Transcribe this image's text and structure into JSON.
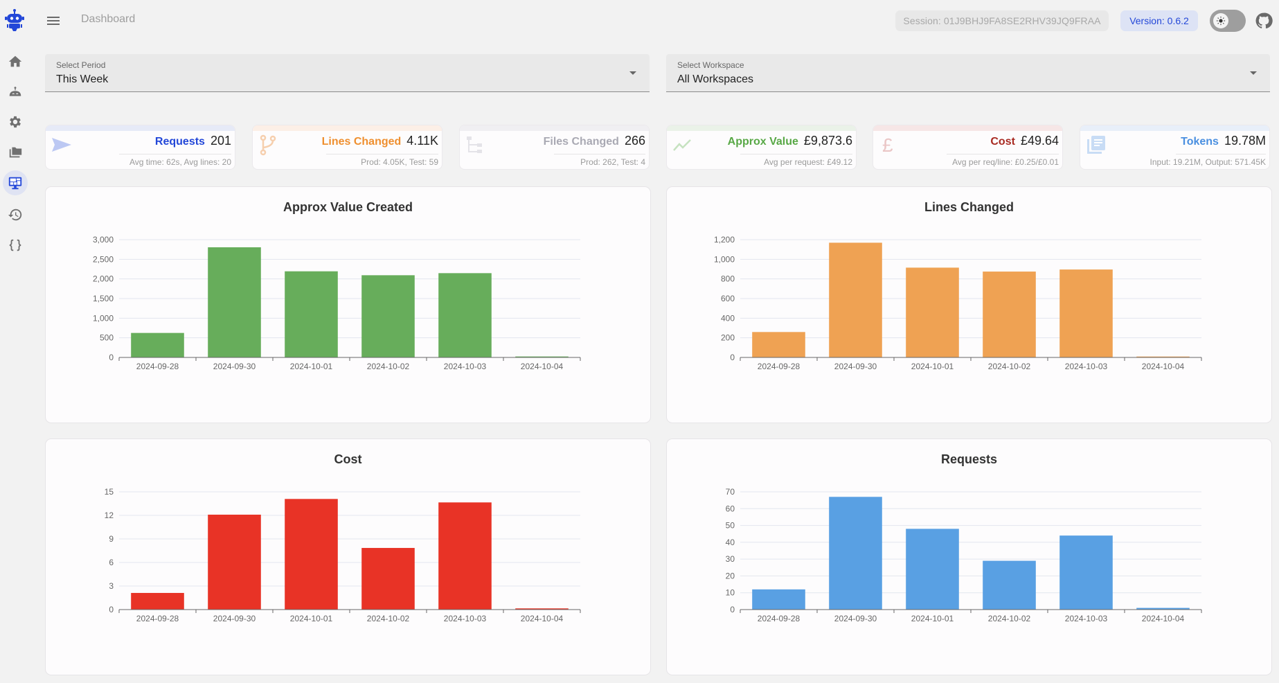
{
  "app": {
    "page_title": "Dashboard",
    "session_label": "Session: 01J9BHJ9FA8SE2RHV39JQ9FRAA",
    "version_label": "Version: 0.6.2",
    "brand_color": "#2347d8"
  },
  "sidebar": {
    "items": [
      {
        "name": "home",
        "icon": "home-icon",
        "active": false
      },
      {
        "name": "agents",
        "icon": "robot-icon",
        "active": false
      },
      {
        "name": "settings",
        "icon": "gear-icon",
        "active": false
      },
      {
        "name": "workspaces",
        "icon": "folders-icon",
        "active": false
      },
      {
        "name": "dashboard",
        "icon": "dashboard-monitor-icon",
        "active": true
      },
      {
        "name": "history",
        "icon": "history-icon",
        "active": false
      },
      {
        "name": "api",
        "icon": "code-braces-icon",
        "active": false
      }
    ]
  },
  "filters": {
    "period": {
      "label": "Select Period",
      "value": "This Week"
    },
    "workspace": {
      "label": "Select Workspace",
      "value": "All Workspaces"
    }
  },
  "stats": [
    {
      "key": "requests",
      "title": "Requests",
      "value": "201",
      "sub": "Avg time: 62s, Avg lines: 20",
      "color": "#2347d8",
      "band": "#e6eaf7",
      "icon": "send-icon"
    },
    {
      "key": "lines",
      "title": "Lines Changed",
      "value": "4.11K",
      "sub": "Prod: 4.05K, Test: 59",
      "color": "#ef8f2f",
      "band": "#fcefe6",
      "icon": "branch-icon"
    },
    {
      "key": "files",
      "title": "Files Changed",
      "value": "266",
      "sub": "Prod: 262, Test: 4",
      "color": "#a9a9b3",
      "band": "#f0eff2",
      "icon": "file-tree-icon"
    },
    {
      "key": "value",
      "title": "Approx Value",
      "value": "£9,873.6",
      "sub": "Avg per request: £49.12",
      "color": "#58a846",
      "band": "#eaf2e8",
      "icon": "trending-up-icon"
    },
    {
      "key": "cost",
      "title": "Cost",
      "value": "£49.64",
      "sub": "Avg per req/line: £0.25/£0.01",
      "color": "#a82a22",
      "band": "#f6e6e6",
      "icon": "pound-icon"
    },
    {
      "key": "tokens",
      "title": "Tokens",
      "value": "19.78M",
      "sub": "Input: 19.21M, Output: 571.45K",
      "color": "#4a8fe0",
      "band": "#e8eff9",
      "icon": "documents-icon"
    }
  ],
  "chart_data": [
    {
      "type": "bar",
      "title": "Approx Value Created",
      "categories": [
        "2024-09-28",
        "2024-09-30",
        "2024-10-01",
        "2024-10-02",
        "2024-10-03",
        "2024-10-04"
      ],
      "values": [
        624,
        2806,
        2194,
        2094,
        2147,
        24
      ],
      "yticks": [
        0,
        500,
        1000,
        1500,
        2000,
        2500,
        3000
      ],
      "ytick_labels": [
        "0",
        "500",
        "1,000",
        "1,500",
        "2,000",
        "2,500",
        "3,000"
      ],
      "ylim": [
        0,
        3000
      ],
      "xlabel": "",
      "ylabel": "",
      "grid": true,
      "color": "#67ad5b"
    },
    {
      "type": "bar",
      "title": "Lines Changed",
      "categories": [
        "2024-09-28",
        "2024-09-30",
        "2024-10-01",
        "2024-10-02",
        "2024-10-03",
        "2024-10-04"
      ],
      "values": [
        259,
        1169,
        915,
        875,
        896,
        9
      ],
      "yticks": [
        0,
        200,
        400,
        600,
        800,
        1000,
        1200
      ],
      "ytick_labels": [
        "0",
        "200",
        "400",
        "600",
        "800",
        "1,000",
        "1,200"
      ],
      "ylim": [
        0,
        1200
      ],
      "xlabel": "",
      "ylabel": "",
      "grid": true,
      "color": "#efa253"
    },
    {
      "type": "bar",
      "title": "Cost",
      "categories": [
        "2024-09-28",
        "2024-09-30",
        "2024-10-01",
        "2024-10-02",
        "2024-10-03",
        "2024-10-04"
      ],
      "values": [
        2.12,
        12.09,
        14.09,
        7.85,
        13.65,
        0.15
      ],
      "yticks": [
        0,
        3,
        6,
        9,
        12,
        15
      ],
      "ytick_labels": [
        "0",
        "3",
        "6",
        "9",
        "12",
        "15"
      ],
      "ylim": [
        0,
        15
      ],
      "xlabel": "",
      "ylabel": "",
      "grid": true,
      "color": "#e83326"
    },
    {
      "type": "bar",
      "title": "Requests",
      "categories": [
        "2024-09-28",
        "2024-09-30",
        "2024-10-01",
        "2024-10-02",
        "2024-10-03",
        "2024-10-04"
      ],
      "values": [
        12,
        67,
        48,
        29,
        44,
        1
      ],
      "yticks": [
        0,
        10,
        20,
        30,
        40,
        50,
        60,
        70
      ],
      "ytick_labels": [
        "0",
        "10",
        "20",
        "30",
        "40",
        "50",
        "60",
        "70"
      ],
      "ylim": [
        0,
        70
      ],
      "xlabel": "",
      "ylabel": "",
      "grid": true,
      "color": "#59a0e3"
    }
  ]
}
